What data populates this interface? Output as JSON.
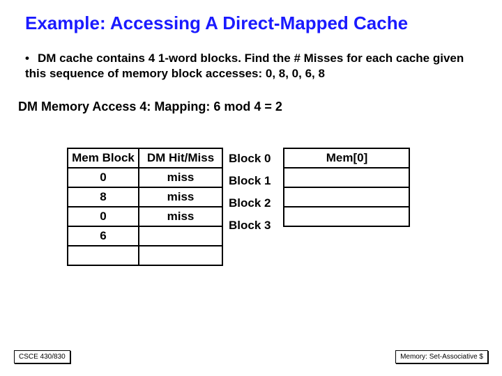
{
  "title": "Example: Accessing A Direct-Mapped Cache",
  "bullet": "DM cache contains 4 1-word blocks. Find the # Misses for each cache given this sequence of memory block accesses: 0, 8, 0, 6, 8",
  "subline": "DM Memory Access 4:  Mapping: 6 mod 4 = 2",
  "left_headers": {
    "c1": "Mem Block",
    "c2": "DM Hit/Miss"
  },
  "left_rows": [
    {
      "c1": "0",
      "c2": "miss"
    },
    {
      "c1": "8",
      "c2": "miss"
    },
    {
      "c1": "0",
      "c2": "miss"
    },
    {
      "c1": "6",
      "c2": ""
    },
    {
      "c1": "",
      "c2": ""
    }
  ],
  "block_labels": [
    "Block 0",
    "Block 1",
    "Block 2",
    "Block 3"
  ],
  "right_header": "Mem[0]",
  "footer_left": "CSCE 430/830",
  "footer_right": "Memory: Set-Associative $"
}
